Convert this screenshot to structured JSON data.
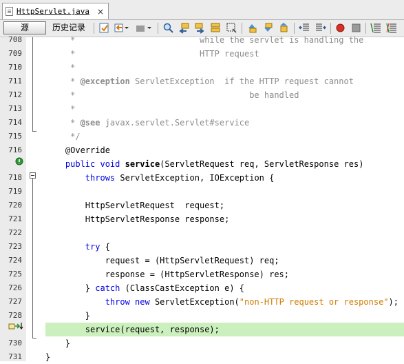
{
  "tab": {
    "label": "HttpServlet.java",
    "close": "×"
  },
  "toolbar": {
    "source_label": "源",
    "history_label": "历史记录"
  },
  "editor": {
    "current_line": "729",
    "lines": [
      {
        "n": "708",
        "html": "<span class=\"cm\">     *                         while the servlet is handling the</span>"
      },
      {
        "n": "709",
        "html": "<span class=\"cm\">     *                         HTTP request</span>"
      },
      {
        "n": "710",
        "html": "<span class=\"cm\">     *</span>"
      },
      {
        "n": "711",
        "html": "<span class=\"cm\">     * </span><span class=\"cmb\">@exception</span><span class=\"cm\"> ServletException  if the HTTP request cannot</span>"
      },
      {
        "n": "712",
        "html": "<span class=\"cm\">     *                                   be handled</span>"
      },
      {
        "n": "713",
        "html": "<span class=\"cm\">     *</span>"
      },
      {
        "n": "714",
        "html": "<span class=\"cm\">     * </span><span class=\"cmb\">@see</span><span class=\"cm\"> javax.servlet.Servlet#service</span>"
      },
      {
        "n": "715",
        "html": "<span class=\"cm\">     */</span>"
      },
      {
        "n": "716",
        "html": "    @Override"
      },
      {
        "n": "",
        "html": "    <span class=\"kw\">public void</span> <span class=\"fn\">service</span>(ServletRequest req, ServletResponse res)"
      },
      {
        "n": "718",
        "html": "        <span class=\"kw\">throws</span> ServletException, IOException {"
      },
      {
        "n": "719",
        "html": ""
      },
      {
        "n": "720",
        "html": "        HttpServletRequest  request;"
      },
      {
        "n": "721",
        "html": "        HttpServletResponse response;"
      },
      {
        "n": "722",
        "html": ""
      },
      {
        "n": "723",
        "html": "        <span class=\"kw\">try</span> {"
      },
      {
        "n": "724",
        "html": "            request = (HttpServletRequest) req;"
      },
      {
        "n": "725",
        "html": "            response = (HttpServletResponse) res;"
      },
      {
        "n": "726",
        "html": "        } <span class=\"kw\">catch</span> (ClassCastException e) {"
      },
      {
        "n": "727",
        "html": "            <span class=\"kw\">throw new</span> ServletException(<span class=\"st\">\"non-HTTP request or response\"</span>);"
      },
      {
        "n": "728",
        "html": "        }"
      },
      {
        "n": "",
        "html": "        service(request, response);"
      },
      {
        "n": "730",
        "html": "    }"
      },
      {
        "n": "731",
        "html": "}"
      }
    ]
  }
}
